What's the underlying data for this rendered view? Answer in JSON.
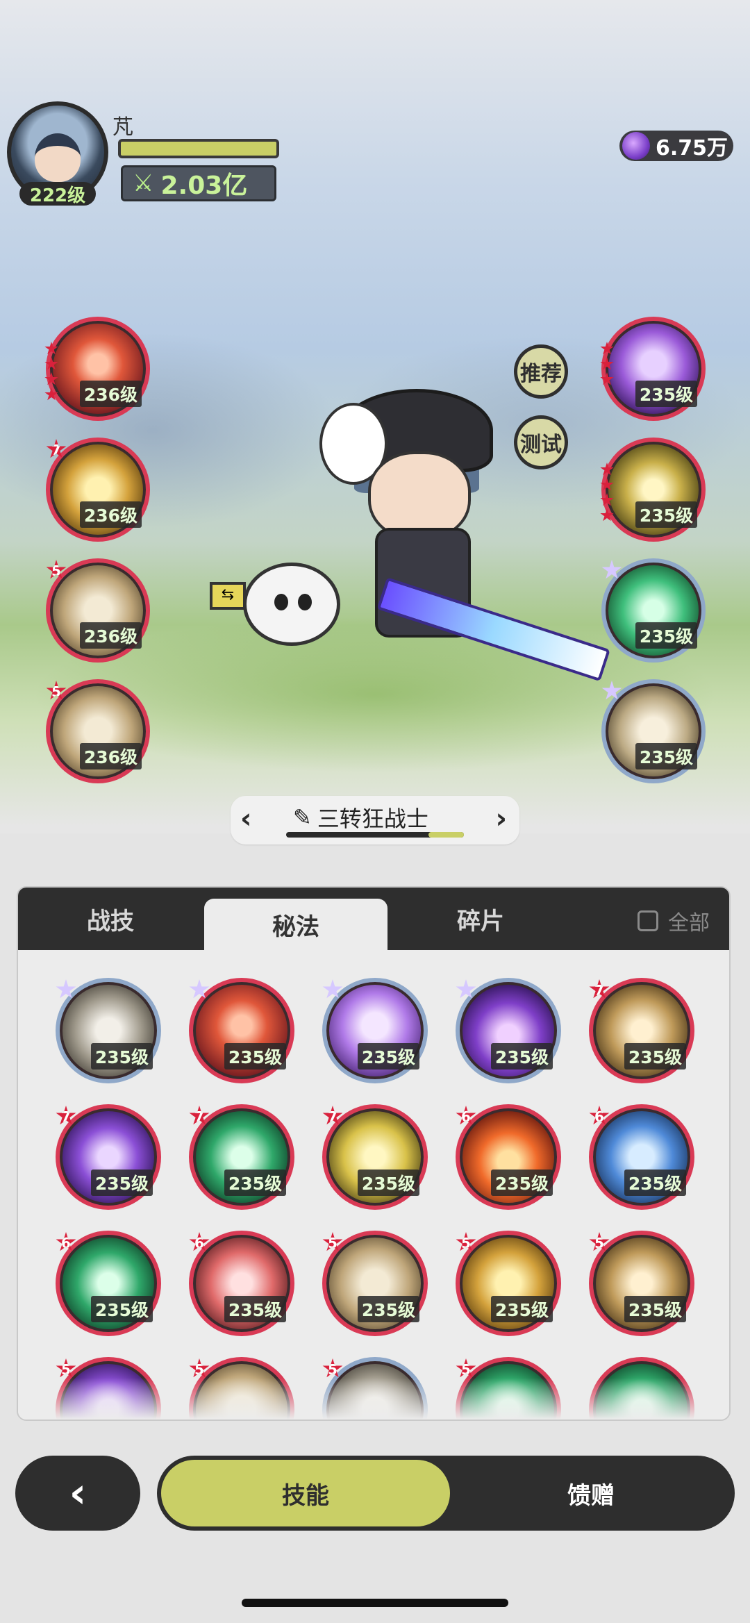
{
  "player": {
    "name": "芃",
    "level": "222级",
    "power": "2.03亿",
    "power_icon": "crossed-swords-icon"
  },
  "currency": {
    "icon": "purple-gem-icon",
    "amount": "6.75万"
  },
  "side_buttons": {
    "recommend": "推荐",
    "test": "测试"
  },
  "left_skills": [
    {
      "level": "236级",
      "stars": 4,
      "theme": "red"
    },
    {
      "level": "236级",
      "badge": "7",
      "theme": "gold"
    },
    {
      "level": "236级",
      "badge": "5",
      "theme": "tan"
    },
    {
      "level": "236级",
      "badge": "5",
      "theme": "tan"
    }
  ],
  "right_skills": [
    {
      "level": "235级",
      "stars": 3,
      "theme": "purple"
    },
    {
      "level": "235级",
      "stars": 4,
      "theme": "eye"
    },
    {
      "level": "235级",
      "badge_pale": true,
      "theme": "green"
    },
    {
      "level": "235级",
      "badge_pale": true,
      "theme": "leaf"
    }
  ],
  "class_selector": {
    "name": "三转狂战士",
    "edit_icon": "pencil-icon",
    "progress": 0.2
  },
  "tabs": [
    "战技",
    "秘法",
    "碎片"
  ],
  "active_tab": 1,
  "filter_all_label": "全部",
  "grid": [
    {
      "level": "235级",
      "badge": "",
      "pale": true,
      "theme": "grey"
    },
    {
      "level": "235级",
      "badge": "",
      "pale": true,
      "theme": "red"
    },
    {
      "level": "235级",
      "badge": "",
      "pale": true,
      "theme": "lilac"
    },
    {
      "level": "235级",
      "badge": "",
      "pale": true,
      "theme": "deeppurple"
    },
    {
      "level": "235级",
      "badge": "7",
      "theme": "ember"
    },
    {
      "level": "235级",
      "badge": "7",
      "theme": "violet"
    },
    {
      "level": "235级",
      "badge": "7",
      "theme": "emerald"
    },
    {
      "level": "235级",
      "badge": "7",
      "theme": "yellow"
    },
    {
      "level": "235级",
      "badge": "6",
      "theme": "fire"
    },
    {
      "level": "235级",
      "badge": "6",
      "theme": "blue"
    },
    {
      "level": "235级",
      "badge": "6",
      "theme": "emerald"
    },
    {
      "level": "235级",
      "badge": "6",
      "theme": "rose"
    },
    {
      "level": "235级",
      "badge": "5",
      "theme": "tan"
    },
    {
      "level": "235级",
      "badge": "5",
      "theme": "gold"
    },
    {
      "level": "235级",
      "badge": "5",
      "theme": "ember"
    },
    {
      "level": "",
      "badge": "5",
      "theme": "violet"
    },
    {
      "level": "",
      "badge": "5",
      "theme": "tan"
    },
    {
      "level": "",
      "badge": "5",
      "theme": "grey"
    },
    {
      "level": "",
      "badge": "5",
      "theme": "emerald"
    },
    {
      "level": "",
      "badge": "",
      "theme": "emerald"
    }
  ],
  "bottom_nav": {
    "back_icon": "chevron-left-icon",
    "skills": "技能",
    "gift": "馈赠"
  }
}
